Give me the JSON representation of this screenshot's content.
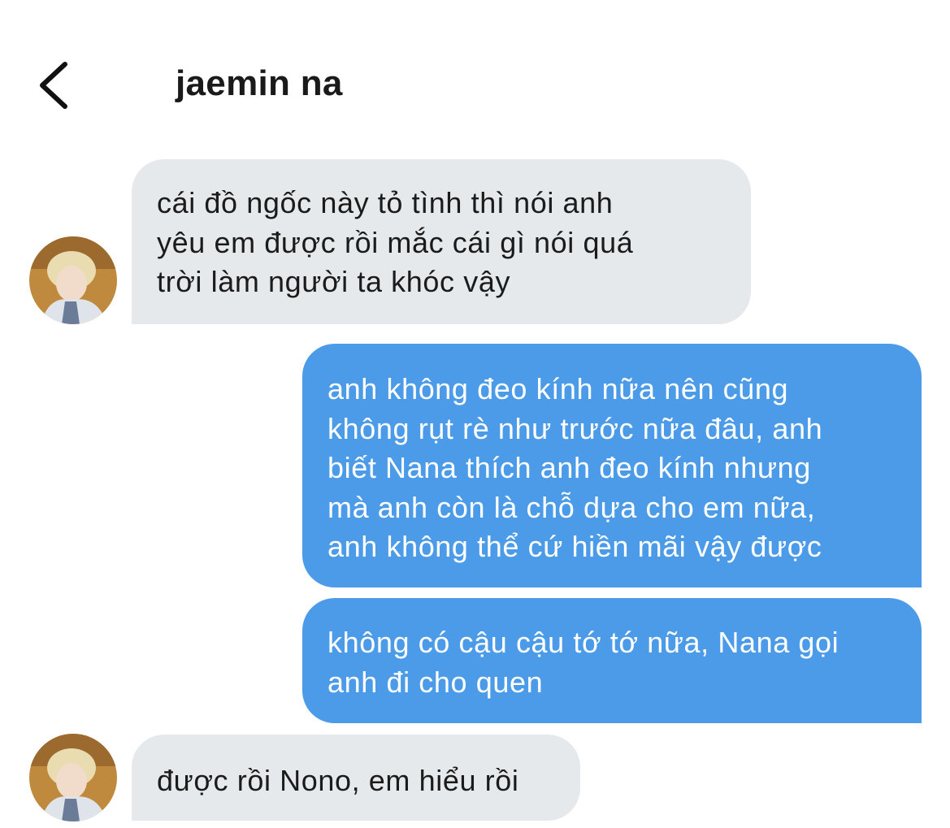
{
  "header": {
    "title": "jaemin na",
    "back_icon": "chevron-left-icon"
  },
  "messages": [
    {
      "direction": "incoming",
      "text": "cái đồ ngốc này tỏ tình thì nói anh\nyêu em được rồi mắc cái gì nói quá\ntrời làm người ta khóc vậy"
    },
    {
      "direction": "outgoing",
      "text": "anh không đeo kính nữa nên cũng\nkhông rụt rè như trước nữa đâu, anh\nbiết Nana thích anh đeo kính nhưng\nmà anh còn là chỗ dựa cho em nữa,\nanh không thể cứ hiền mãi vậy được"
    },
    {
      "direction": "outgoing",
      "text": "không có cậu cậu tớ tớ nữa, Nana gọi\nanh đi cho quen"
    },
    {
      "direction": "incoming",
      "text": "được rồi Nono, em hiểu rồi"
    }
  ],
  "colors": {
    "incoming_bubble": "#e6e9ec",
    "outgoing_bubble": "#4b9be8",
    "outgoing_text": "#ffffff"
  }
}
